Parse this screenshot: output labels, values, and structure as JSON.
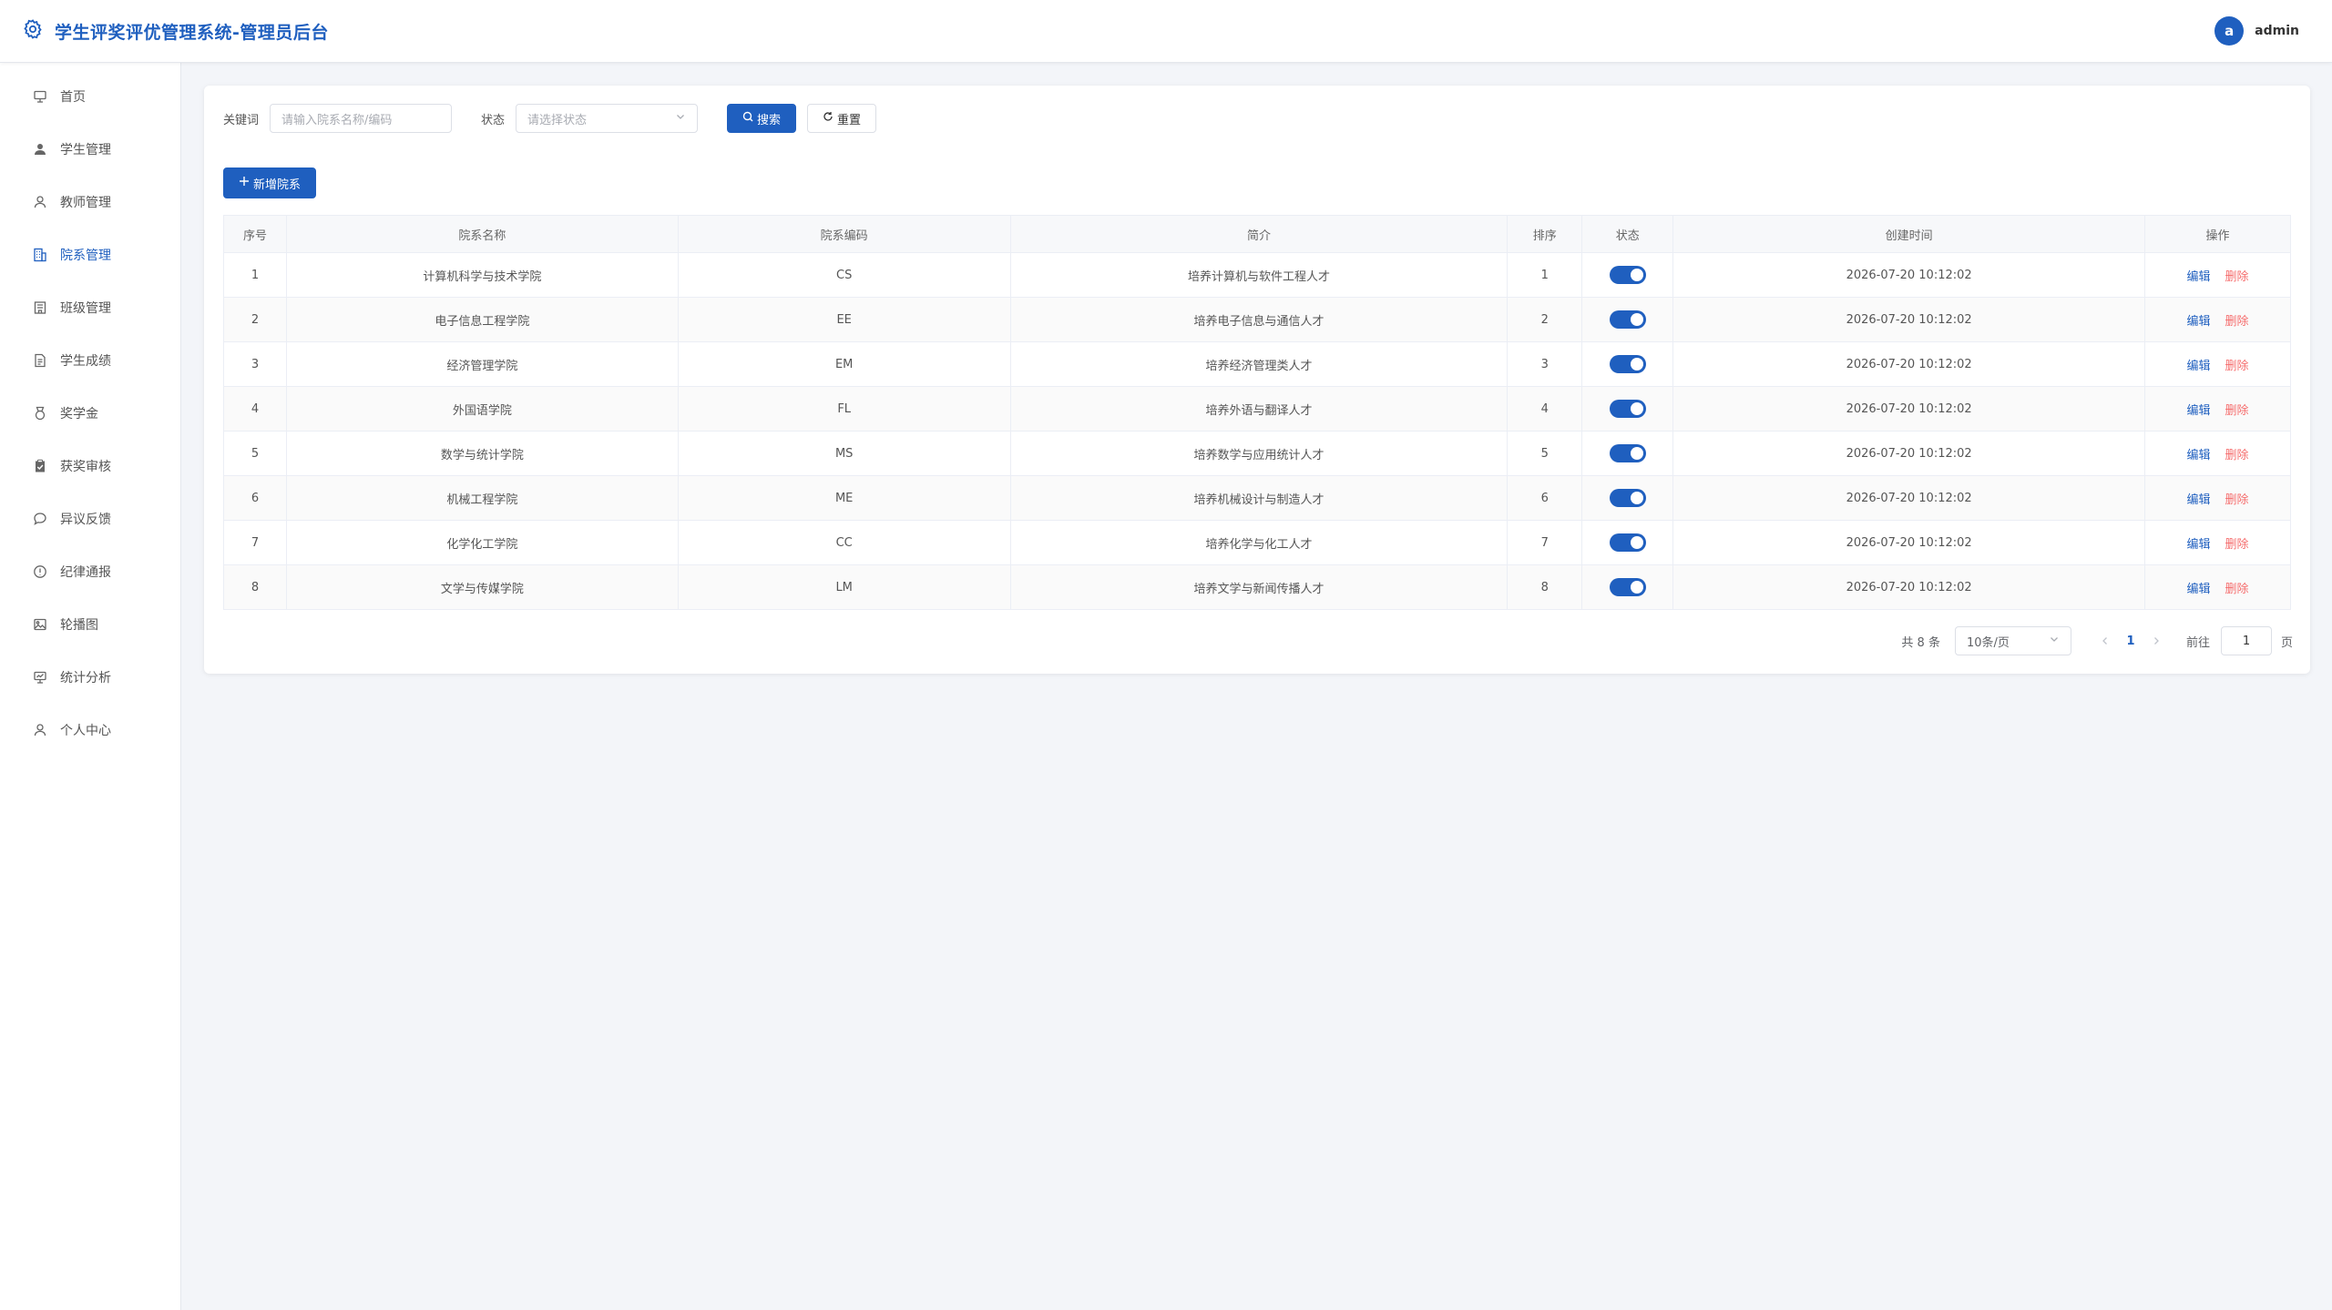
{
  "header": {
    "title": "学生评奖评优管理系统-管理员后台",
    "avatar_letter": "a",
    "username": "admin",
    "accent_color": "#1f5fbf"
  },
  "sidebar": {
    "items": [
      {
        "label": "首页",
        "icon": "dashboard-icon"
      },
      {
        "label": "学生管理",
        "icon": "user-filled-icon"
      },
      {
        "label": "教师管理",
        "icon": "user-icon"
      },
      {
        "label": "院系管理",
        "icon": "office-building-icon",
        "active": true
      },
      {
        "label": "班级管理",
        "icon": "school-icon"
      },
      {
        "label": "学生成绩",
        "icon": "document-icon"
      },
      {
        "label": "奖学金",
        "icon": "medal-icon"
      },
      {
        "label": "获奖审核",
        "icon": "checklist-icon"
      },
      {
        "label": "异议反馈",
        "icon": "chat-icon"
      },
      {
        "label": "纪律通报",
        "icon": "warning-icon"
      },
      {
        "label": "轮播图",
        "icon": "picture-icon"
      },
      {
        "label": "统计分析",
        "icon": "chart-icon"
      },
      {
        "label": "个人中心",
        "icon": "user-icon"
      }
    ]
  },
  "filter": {
    "keyword_label": "关键词",
    "keyword_placeholder": "请输入院系名称/编码",
    "status_label": "状态",
    "status_placeholder": "请选择状态",
    "search_label": "搜索",
    "reset_label": "重置"
  },
  "toolbar": {
    "add_label": "新增院系"
  },
  "table": {
    "columns": [
      "序号",
      "院系名称",
      "院系编码",
      "简介",
      "排序",
      "状态",
      "创建时间",
      "操作"
    ],
    "edit_label": "编辑",
    "delete_label": "删除",
    "rows": [
      {
        "no": "1",
        "name": "计算机科学与技术学院",
        "code": "CS",
        "intro": "培养计算机与软件工程人才",
        "sort": "1",
        "enabled": true,
        "created": "2026-07-20 10:12:02"
      },
      {
        "no": "2",
        "name": "电子信息工程学院",
        "code": "EE",
        "intro": "培养电子信息与通信人才",
        "sort": "2",
        "enabled": true,
        "created": "2026-07-20 10:12:02"
      },
      {
        "no": "3",
        "name": "经济管理学院",
        "code": "EM",
        "intro": "培养经济管理类人才",
        "sort": "3",
        "enabled": true,
        "created": "2026-07-20 10:12:02"
      },
      {
        "no": "4",
        "name": "外国语学院",
        "code": "FL",
        "intro": "培养外语与翻译人才",
        "sort": "4",
        "enabled": true,
        "created": "2026-07-20 10:12:02"
      },
      {
        "no": "5",
        "name": "数学与统计学院",
        "code": "MS",
        "intro": "培养数学与应用统计人才",
        "sort": "5",
        "enabled": true,
        "created": "2026-07-20 10:12:02"
      },
      {
        "no": "6",
        "name": "机械工程学院",
        "code": "ME",
        "intro": "培养机械设计与制造人才",
        "sort": "6",
        "enabled": true,
        "created": "2026-07-20 10:12:02"
      },
      {
        "no": "7",
        "name": "化学化工学院",
        "code": "CC",
        "intro": "培养化学与化工人才",
        "sort": "7",
        "enabled": true,
        "created": "2026-07-20 10:12:02"
      },
      {
        "no": "8",
        "name": "文学与传媒学院",
        "code": "LM",
        "intro": "培养文学与新闻传播人才",
        "sort": "8",
        "enabled": true,
        "created": "2026-07-20 10:12:02"
      }
    ]
  },
  "pagination": {
    "total_text": "共 8 条",
    "page_size": "10条/页",
    "current_page": "1",
    "goto_label": "前往",
    "goto_value": "1",
    "page_suffix": "页"
  }
}
